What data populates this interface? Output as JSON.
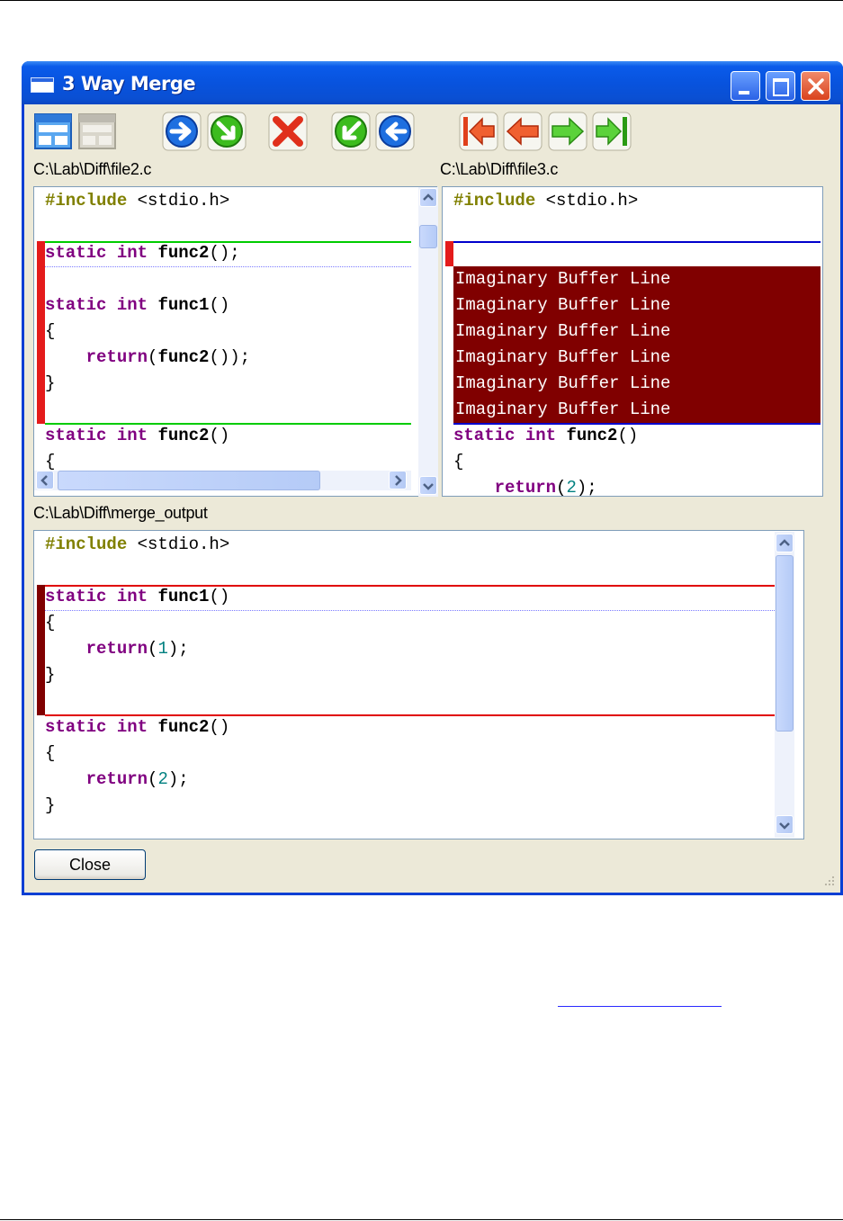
{
  "window": {
    "title": "3 Way Merge"
  },
  "toolbar": {
    "buttons": [
      "layout-horizontal-icon",
      "layout-vertical-icon",
      "arrow-right-blue-icon",
      "arrow-down-right-green-icon",
      "delete-red-x-icon",
      "arrow-down-left-green-icon",
      "arrow-left-blue-icon",
      "first-diff-icon",
      "previous-diff-icon",
      "next-diff-icon",
      "last-diff-icon"
    ]
  },
  "left": {
    "path": "C:\\Lab\\Diff\\file2.c"
  },
  "right": {
    "path": "C:\\Lab\\Diff\\file3.c"
  },
  "output": {
    "path": "C:\\Lab\\Diff\\merge_output"
  },
  "code": {
    "include_kw": "#include",
    "include_arg": " <stdio.h>",
    "static": "static",
    "int": "int",
    "func1": "func1",
    "func2": "func2",
    "parens": "()",
    "proto_tail": "();",
    "open_brace": "{",
    "close_brace": "}",
    "return_kw": "return",
    "ret_call_open": "(",
    "ret_call_tail": "());",
    "ret_open": "(",
    "ret_close": ");",
    "one": "1",
    "two": "2",
    "imaginary": "Imaginary Buffer Line"
  },
  "buttons": {
    "close": "Close"
  },
  "colors": {
    "insert_line": "#00cc00",
    "removed_line": "#0000cc",
    "conflict_line": "#e00000",
    "imaginary_bg": "#800000",
    "margin_red": "#e41b1b",
    "margin_dark": "#800000"
  }
}
